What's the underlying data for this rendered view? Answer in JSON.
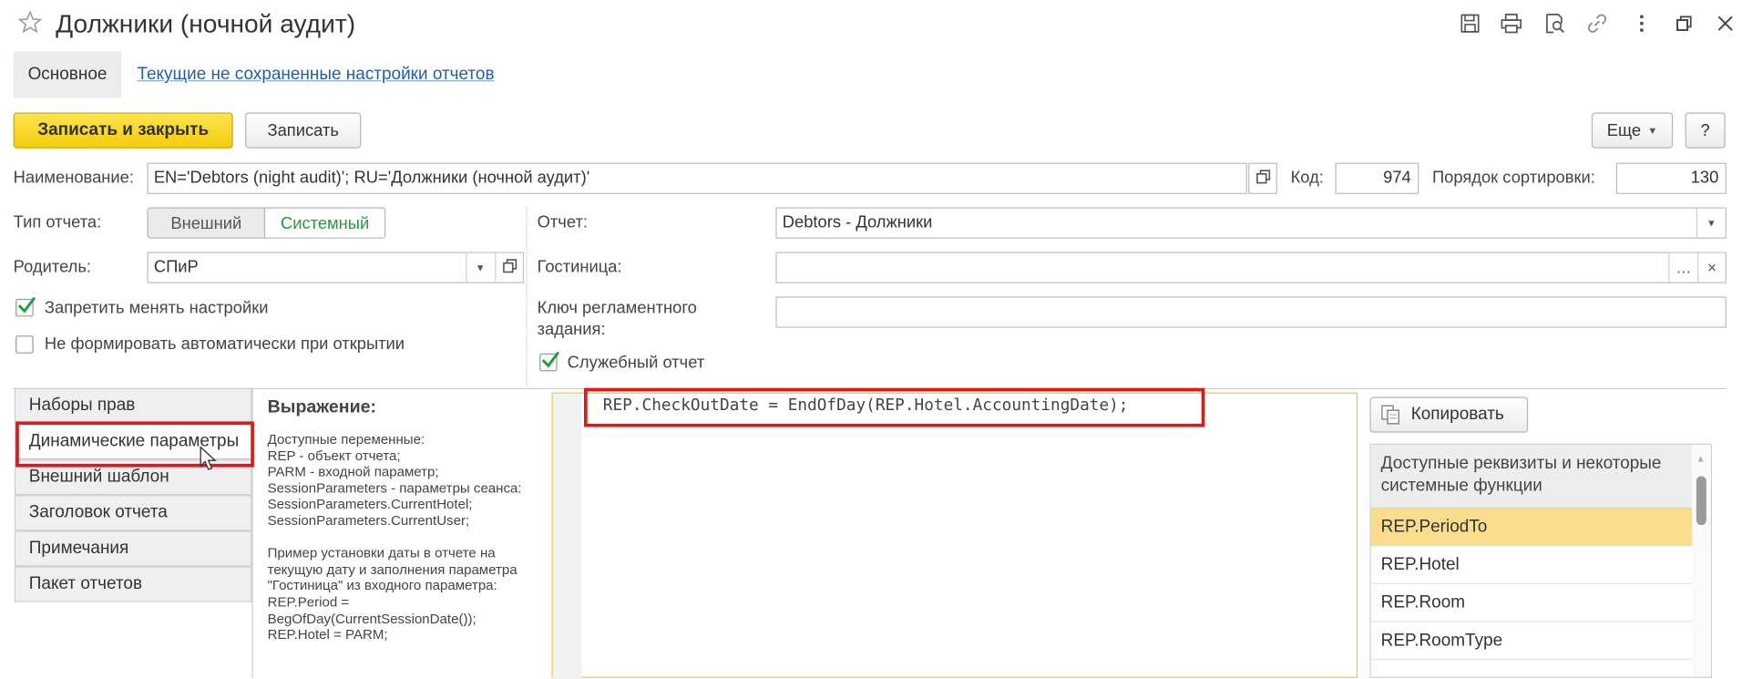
{
  "window": {
    "title": "Должники (ночной аудит)"
  },
  "nav": {
    "main_tab": "Основное",
    "settings_link": "Текущие не сохраненные настройки отчетов"
  },
  "toolbar": {
    "save_close": "Записать и закрыть",
    "save": "Записать",
    "more": "Еще",
    "help": "?"
  },
  "form": {
    "name_label": "Наименование:",
    "name_value": "EN='Debtors (night audit)'; RU='Должники (ночной аудит)'",
    "code_label": "Код:",
    "code_value": "974",
    "sort_label": "Порядок сортировки:",
    "sort_value": "130",
    "type_label": "Тип отчета:",
    "type_external": "Внешний",
    "type_system": "Системный",
    "report_label": "Отчет:",
    "report_value": "Debtors - Должники",
    "parent_label": "Родитель:",
    "parent_value": "СПиР",
    "hotel_label": "Гостиница:",
    "hotel_value": "",
    "job_key_label": "Ключ регламентного задания:",
    "job_key_value": "",
    "forbid_settings_label": "Запретить менять настройки",
    "forbid_settings_checked": true,
    "no_autogen_label": "Не формировать автоматически при открытии",
    "no_autogen_checked": false,
    "service_report_label": "Служебный отчет",
    "service_report_checked": true
  },
  "side_tabs": [
    {
      "label": "Наборы прав"
    },
    {
      "label": "Динамические параметры"
    },
    {
      "label": "Внешний шаблон"
    },
    {
      "label": "Заголовок отчета"
    },
    {
      "label": "Примечания"
    },
    {
      "label": "Пакет отчетов"
    }
  ],
  "expression": {
    "title": "Выражение:",
    "help_text": "Доступные переменные:\nREP - объект отчета;\nPARM - входной параметр;\nSessionParameters - параметры сеанса:\nSessionParameters.CurrentHotel;\nSessionParameters.CurrentUser;\n\nПример установки даты в отчете на\nтекущую дату и заполнения параметра\n\"Гостиница\" из входного параметра:\nREP.Period =\nBegOfDay(CurrentSessionDate());\nREP.Hotel = PARM;",
    "code": "REP.CheckOutDate = EndOfDay(REP.Hotel.AccountingDate);"
  },
  "attributes": {
    "copy_button": "Копировать",
    "header": "Доступные реквизиты и некоторые системные функции",
    "items": [
      "REP.PeriodTo",
      "REP.Hotel",
      "REP.Room",
      "REP.RoomType"
    ]
  },
  "colors": {
    "primary_button": "#f5d30f",
    "highlight_red": "#e3161b",
    "selected_row": "#fadd8c",
    "system_green": "#1e9e3a",
    "link_blue": "#1e5eb4"
  }
}
